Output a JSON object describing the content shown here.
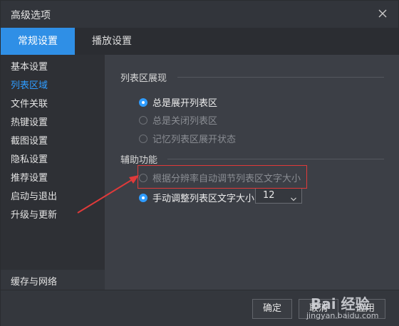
{
  "window": {
    "title": "高级选项"
  },
  "tabs": [
    {
      "label": "常规设置",
      "active": true
    },
    {
      "label": "播放设置",
      "active": false
    }
  ],
  "sidebar": {
    "items": [
      {
        "label": "基本设置",
        "active": false
      },
      {
        "label": "列表区域",
        "active": true
      },
      {
        "label": "文件关联",
        "active": false
      },
      {
        "label": "热键设置",
        "active": false
      },
      {
        "label": "截图设置",
        "active": false
      },
      {
        "label": "隐私设置",
        "active": false
      },
      {
        "label": "推荐设置",
        "active": false
      },
      {
        "label": "启动与退出",
        "active": false
      },
      {
        "label": "升级与更新",
        "active": false
      }
    ],
    "bottom_item": "缓存与网络"
  },
  "list_display": {
    "title": "列表区展现",
    "options": [
      {
        "label": "总是展开列表区",
        "checked": true,
        "disabled": false
      },
      {
        "label": "总是关闭列表区",
        "checked": false,
        "disabled": true
      },
      {
        "label": "记忆列表区展开状态",
        "checked": false,
        "disabled": true
      }
    ]
  },
  "assist": {
    "title": "辅助功能",
    "auto_font_label": "根据分辨率自动调节列表区文字大小",
    "manual_font_label": "手动调整列表区文字大小",
    "font_size_value": "12"
  },
  "footer": {
    "ok_label": "确定",
    "cancel_label": "取消",
    "apply_label": "应用"
  },
  "watermark": {
    "logo": "Bai 经验",
    "sub": "jingyan.baidu.com"
  },
  "colors": {
    "accent": "#2f8fe6",
    "annotation": "#e03a3a"
  }
}
